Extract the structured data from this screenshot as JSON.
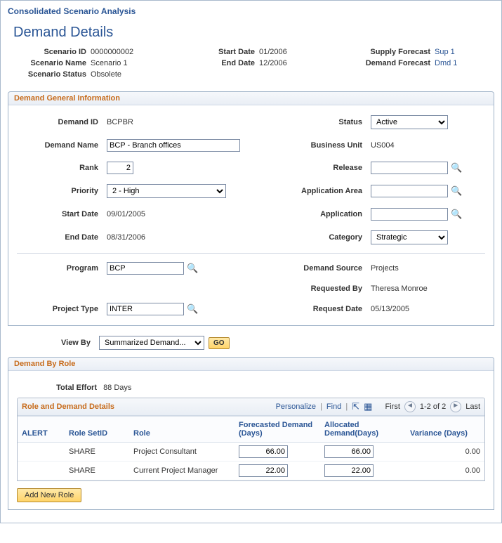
{
  "breadcrumb": "Consolidated Scenario Analysis",
  "page_title": "Demand Details",
  "header": {
    "scenario_id_label": "Scenario ID",
    "scenario_id": "0000000002",
    "scenario_name_label": "Scenario Name",
    "scenario_name": "Scenario 1",
    "scenario_status_label": "Scenario Status",
    "scenario_status": "Obsolete",
    "start_date_label": "Start Date",
    "start_date": "01/2006",
    "end_date_label": "End Date",
    "end_date": "12/2006",
    "supply_forecast_label": "Supply Forecast",
    "supply_forecast_link": "Sup 1",
    "demand_forecast_label": "Demand Forecast",
    "demand_forecast_link": "Dmd 1"
  },
  "general": {
    "title": "Demand General Information",
    "demand_id_label": "Demand ID",
    "demand_id": "BCPBR",
    "demand_name_label": "Demand Name",
    "demand_name": "BCP - Branch offices",
    "rank_label": "Rank",
    "rank": "2",
    "priority_label": "Priority",
    "priority": "2 - High",
    "start_date_label": "Start Date",
    "start_date": "09/01/2005",
    "end_date_label": "End Date",
    "end_date": "08/31/2006",
    "status_label": "Status",
    "status": "Active",
    "business_unit_label": "Business Unit",
    "business_unit": "US004",
    "release_label": "Release",
    "release": "",
    "application_area_label": "Application Area",
    "application_area": "",
    "application_label": "Application",
    "application": "",
    "category_label": "Category",
    "category": "Strategic",
    "program_label": "Program",
    "program": "BCP",
    "project_type_label": "Project Type",
    "project_type": "INTER",
    "demand_source_label": "Demand Source",
    "demand_source": "Projects",
    "requested_by_label": "Requested By",
    "requested_by": "Theresa Monroe",
    "request_date_label": "Request Date",
    "request_date": "05/13/2005"
  },
  "viewby": {
    "label": "View By",
    "value": "Summarized Demand...",
    "go_label": "GO"
  },
  "by_role": {
    "title": "Demand By Role",
    "total_effort_label": "Total Effort",
    "total_effort": "88 Days",
    "sub_title": "Role and Demand Details",
    "tools": {
      "personalize": "Personalize",
      "find": "Find",
      "first": "First",
      "pager": "1-2 of 2",
      "last": "Last"
    },
    "columns": {
      "alert": "ALERT",
      "role_setid": "Role SetID",
      "role": "Role",
      "forecasted": "Forecasted Demand (Days)",
      "allocated": "Allocated Demand(Days)",
      "variance": "Variance (Days)"
    },
    "rows": [
      {
        "alert": "",
        "role_setid": "SHARE",
        "role": "Project Consultant",
        "forecasted": "66.00",
        "allocated": "66.00",
        "variance": "0.00"
      },
      {
        "alert": "",
        "role_setid": "SHARE",
        "role": "Current Project Manager",
        "forecasted": "22.00",
        "allocated": "22.00",
        "variance": "0.00"
      }
    ],
    "add_button": "Add New Role"
  }
}
